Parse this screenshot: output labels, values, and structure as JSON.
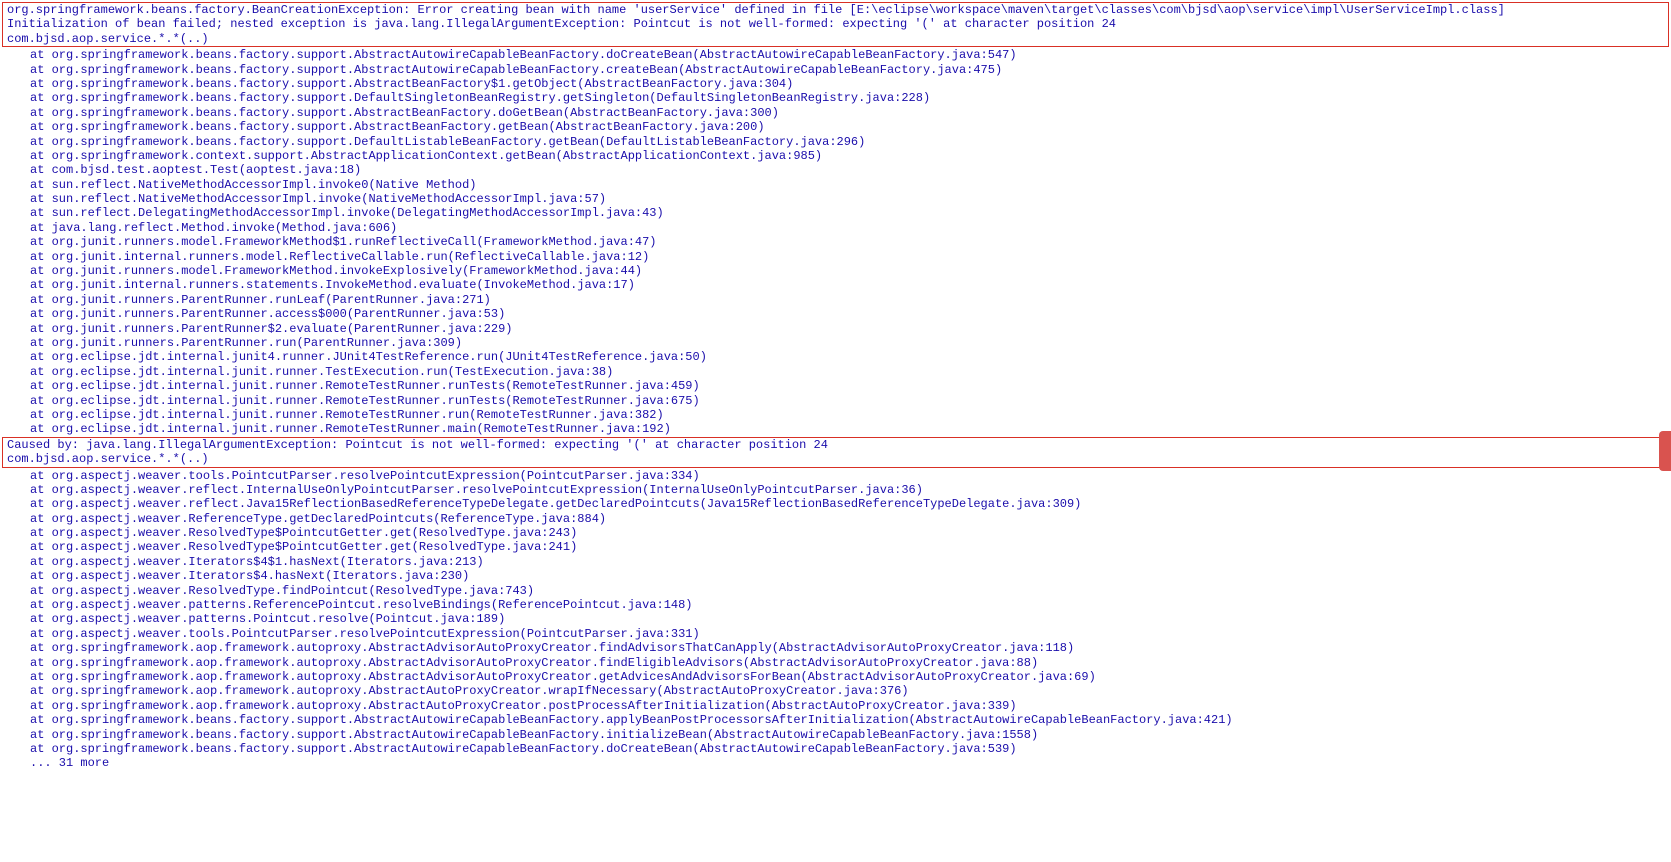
{
  "exception_header": {
    "line1": "org.springframework.beans.factory.BeanCreationException: Error creating bean with name 'userService' defined in file [E:\\eclipse\\workspace\\maven\\target\\classes\\com\\bjsd\\aop\\service\\impl\\UserServiceImpl.class]",
    "line2": "Initialization of bean failed; nested exception is java.lang.IllegalArgumentException: Pointcut is not well-formed: expecting '(' at character position 24",
    "line3": "com.bjsd.aop.service.*.*(..)"
  },
  "stack1": [
    "at org.springframework.beans.factory.support.AbstractAutowireCapableBeanFactory.doCreateBean(AbstractAutowireCapableBeanFactory.java:547)",
    "at org.springframework.beans.factory.support.AbstractAutowireCapableBeanFactory.createBean(AbstractAutowireCapableBeanFactory.java:475)",
    "at org.springframework.beans.factory.support.AbstractBeanFactory$1.getObject(AbstractBeanFactory.java:304)",
    "at org.springframework.beans.factory.support.DefaultSingletonBeanRegistry.getSingleton(DefaultSingletonBeanRegistry.java:228)",
    "at org.springframework.beans.factory.support.AbstractBeanFactory.doGetBean(AbstractBeanFactory.java:300)",
    "at org.springframework.beans.factory.support.AbstractBeanFactory.getBean(AbstractBeanFactory.java:200)",
    "at org.springframework.beans.factory.support.DefaultListableBeanFactory.getBean(DefaultListableBeanFactory.java:296)",
    "at org.springframework.context.support.AbstractApplicationContext.getBean(AbstractApplicationContext.java:985)",
    "at com.bjsd.test.aoptest.Test(aoptest.java:18)",
    "at sun.reflect.NativeMethodAccessorImpl.invoke0(Native Method)",
    "at sun.reflect.NativeMethodAccessorImpl.invoke(NativeMethodAccessorImpl.java:57)",
    "at sun.reflect.DelegatingMethodAccessorImpl.invoke(DelegatingMethodAccessorImpl.java:43)",
    "at java.lang.reflect.Method.invoke(Method.java:606)",
    "at org.junit.runners.model.FrameworkMethod$1.runReflectiveCall(FrameworkMethod.java:47)",
    "at org.junit.internal.runners.model.ReflectiveCallable.run(ReflectiveCallable.java:12)",
    "at org.junit.runners.model.FrameworkMethod.invokeExplosively(FrameworkMethod.java:44)",
    "at org.junit.internal.runners.statements.InvokeMethod.evaluate(InvokeMethod.java:17)",
    "at org.junit.runners.ParentRunner.runLeaf(ParentRunner.java:271)",
    "at org.junit.runners.ParentRunner.access$000(ParentRunner.java:53)",
    "at org.junit.runners.ParentRunner$2.evaluate(ParentRunner.java:229)",
    "at org.junit.runners.ParentRunner.run(ParentRunner.java:309)",
    "at org.eclipse.jdt.internal.junit4.runner.JUnit4TestReference.run(JUnit4TestReference.java:50)",
    "at org.eclipse.jdt.internal.junit.runner.TestExecution.run(TestExecution.java:38)",
    "at org.eclipse.jdt.internal.junit.runner.RemoteTestRunner.runTests(RemoteTestRunner.java:459)",
    "at org.eclipse.jdt.internal.junit.runner.RemoteTestRunner.runTests(RemoteTestRunner.java:675)",
    "at org.eclipse.jdt.internal.junit.runner.RemoteTestRunner.run(RemoteTestRunner.java:382)",
    "at org.eclipse.jdt.internal.junit.runner.RemoteTestRunner.main(RemoteTestRunner.java:192)"
  ],
  "caused_by": {
    "line1": "Caused by: java.lang.IllegalArgumentException: Pointcut is not well-formed: expecting '(' at character position 24",
    "line2": "com.bjsd.aop.service.*.*(..)"
  },
  "stack2": [
    "at org.aspectj.weaver.tools.PointcutParser.resolvePointcutExpression(PointcutParser.java:334)",
    "at org.aspectj.weaver.reflect.InternalUseOnlyPointcutParser.resolvePointcutExpression(InternalUseOnlyPointcutParser.java:36)",
    "at org.aspectj.weaver.reflect.Java15ReflectionBasedReferenceTypeDelegate.getDeclaredPointcuts(Java15ReflectionBasedReferenceTypeDelegate.java:309)",
    "at org.aspectj.weaver.ReferenceType.getDeclaredPointcuts(ReferenceType.java:884)",
    "at org.aspectj.weaver.ResolvedType$PointcutGetter.get(ResolvedType.java:243)",
    "at org.aspectj.weaver.ResolvedType$PointcutGetter.get(ResolvedType.java:241)",
    "at org.aspectj.weaver.Iterators$4$1.hasNext(Iterators.java:213)",
    "at org.aspectj.weaver.Iterators$4.hasNext(Iterators.java:230)",
    "at org.aspectj.weaver.ResolvedType.findPointcut(ResolvedType.java:743)",
    "at org.aspectj.weaver.patterns.ReferencePointcut.resolveBindings(ReferencePointcut.java:148)",
    "at org.aspectj.weaver.patterns.Pointcut.resolve(Pointcut.java:189)",
    "at org.aspectj.weaver.tools.PointcutParser.resolvePointcutExpression(PointcutParser.java:331)",
    "at org.springframework.aop.framework.autoproxy.AbstractAdvisorAutoProxyCreator.findAdvisorsThatCanApply(AbstractAdvisorAutoProxyCreator.java:118)",
    "at org.springframework.aop.framework.autoproxy.AbstractAdvisorAutoProxyCreator.findEligibleAdvisors(AbstractAdvisorAutoProxyCreator.java:88)",
    "at org.springframework.aop.framework.autoproxy.AbstractAdvisorAutoProxyCreator.getAdvicesAndAdvisorsForBean(AbstractAdvisorAutoProxyCreator.java:69)",
    "at org.springframework.aop.framework.autoproxy.AbstractAutoProxyCreator.wrapIfNecessary(AbstractAutoProxyCreator.java:376)",
    "at org.springframework.aop.framework.autoproxy.AbstractAutoProxyCreator.postProcessAfterInitialization(AbstractAutoProxyCreator.java:339)",
    "at org.springframework.beans.factory.support.AbstractAutowireCapableBeanFactory.applyBeanPostProcessorsAfterInitialization(AbstractAutowireCapableBeanFactory.java:421)",
    "at org.springframework.beans.factory.support.AbstractAutowireCapableBeanFactory.initializeBean(AbstractAutowireCapableBeanFactory.java:1558)",
    "at org.springframework.beans.factory.support.AbstractAutowireCapableBeanFactory.doCreateBean(AbstractAutowireCapableBeanFactory.java:539)"
  ],
  "more": "... 31 more"
}
